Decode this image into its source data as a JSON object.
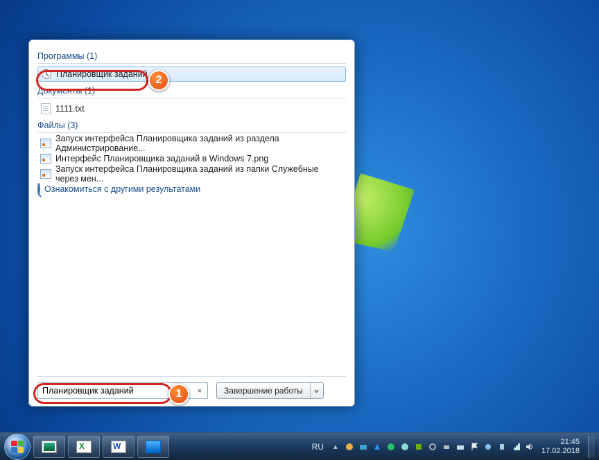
{
  "search": {
    "value": "Планировщик заданий",
    "sections": {
      "programs": {
        "label": "Программы (1)",
        "item": "Планировщик заданий"
      },
      "documents": {
        "label": "Документы (1)",
        "item": "1111.txt"
      },
      "files": {
        "label": "Файлы (3)",
        "items": [
          "Запуск интерфейса Планировщика заданий из раздела Администрирование...",
          "Интерфейс Планировщика заданий в Windows 7.png",
          "Запуск интерфейса Планировщика заданий из папки Служебные через мен..."
        ]
      }
    },
    "more_results": "Ознакомиться с другими результатами",
    "clear_glyph": "×"
  },
  "shutdown": {
    "label": "Завершение работы"
  },
  "callouts": {
    "one": "1",
    "two": "2"
  },
  "taskbar": {
    "lang": "RU",
    "tray_up": "▴",
    "clock": {
      "time": "21:45",
      "date": "17.02.2018"
    }
  }
}
